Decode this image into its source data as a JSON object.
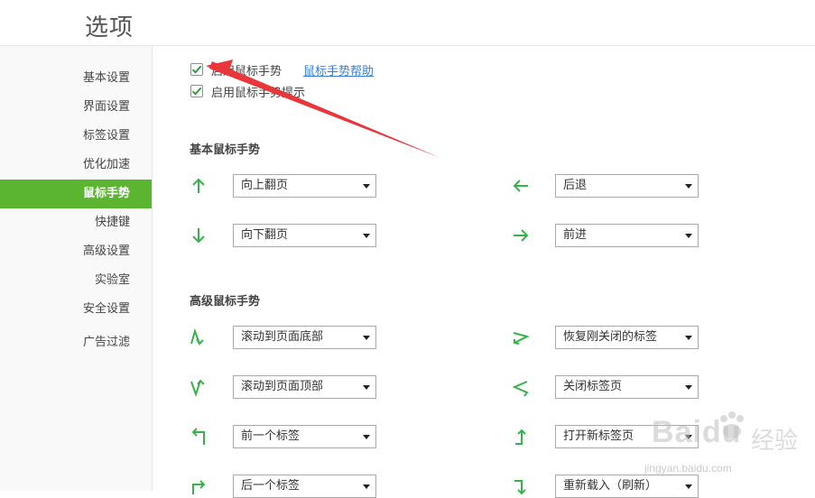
{
  "header": {
    "title": "选项"
  },
  "sidebar": {
    "items": [
      {
        "label": "基本设置",
        "active": false
      },
      {
        "label": "界面设置",
        "active": false
      },
      {
        "label": "标签设置",
        "active": false
      },
      {
        "label": "优化加速",
        "active": false
      },
      {
        "label": "鼠标手势",
        "active": true
      },
      {
        "label": "快捷键",
        "active": false
      },
      {
        "label": "高级设置",
        "active": false
      },
      {
        "label": "实验室",
        "active": false
      },
      {
        "label": "安全设置",
        "active": false
      },
      {
        "label": "广告过滤",
        "active": false
      }
    ],
    "active_color": "#5cb531"
  },
  "options": {
    "enable_gesture": {
      "label": "启用鼠标手势",
      "checked": true
    },
    "help_link": "鼠标手势帮助",
    "enable_hint": {
      "label": "启用鼠标手势提示",
      "checked": true
    }
  },
  "basic": {
    "title": "基本鼠标手势",
    "rows": [
      {
        "left": {
          "icon": "arrow-up-icon",
          "value": "向上翻页"
        },
        "right": {
          "icon": "arrow-left-icon",
          "value": "后退"
        }
      },
      {
        "left": {
          "icon": "arrow-down-icon",
          "value": "向下翻页"
        },
        "right": {
          "icon": "arrow-right-icon",
          "value": "前进"
        }
      }
    ]
  },
  "advanced": {
    "title": "高级鼠标手势",
    "rows": [
      {
        "left": {
          "icon": "gesture-up-down-icon",
          "value": "滚动到页面底部"
        },
        "right": {
          "icon": "gesture-right-left-icon",
          "value": "恢复刚关闭的标签"
        }
      },
      {
        "left": {
          "icon": "gesture-down-up-icon",
          "value": "滚动到页面顶部"
        },
        "right": {
          "icon": "gesture-left-right-icon",
          "value": "关闭标签页"
        }
      },
      {
        "left": {
          "icon": "gesture-up-left-icon",
          "value": "前一个标签"
        },
        "right": {
          "icon": "gesture-left-up-icon",
          "value": "打开新标签页"
        }
      },
      {
        "left": {
          "icon": "gesture-up-right-icon",
          "value": "后一个标签"
        },
        "right": {
          "icon": "gesture-right-down-icon",
          "value": "重新载入（刷新）"
        }
      }
    ]
  },
  "icon_color": "#35b24a",
  "annotation_arrow_color": "#e8373a",
  "watermark": {
    "brand": "Baidu",
    "text": "经验",
    "url": "jingyan.baidu.com"
  }
}
